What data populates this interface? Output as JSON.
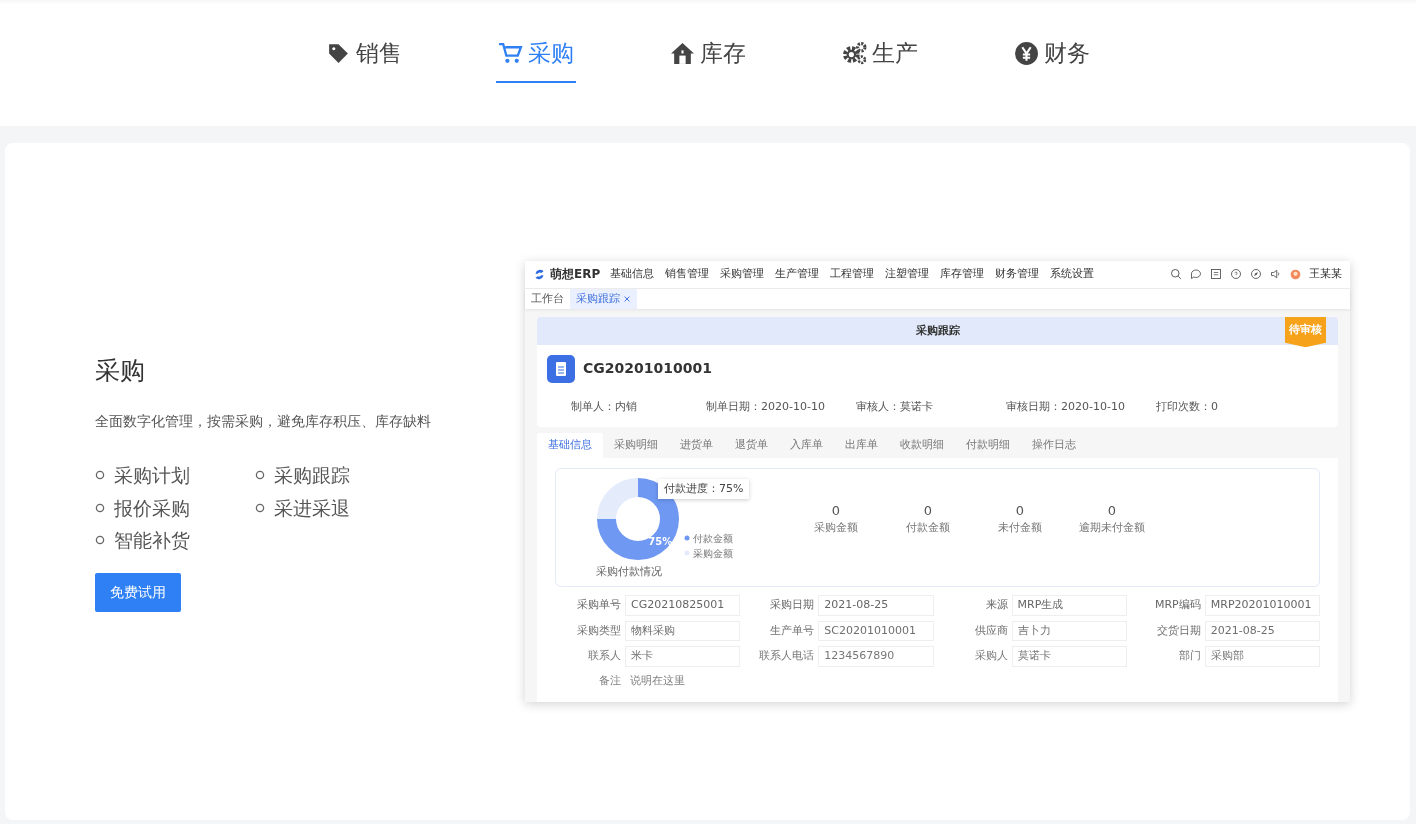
{
  "feature_tabs": [
    {
      "label": "销售",
      "kind": "tag",
      "selected": false
    },
    {
      "label": "采购",
      "kind": "cart",
      "selected": true
    },
    {
      "label": "库存",
      "kind": "house",
      "selected": false
    },
    {
      "label": "生产",
      "kind": "gears",
      "selected": false
    },
    {
      "label": "财务",
      "kind": "yen",
      "selected": false
    }
  ],
  "feature": {
    "title": "采购",
    "description": "全面数字化管理，按需采购，避免库存积压、库存缺料",
    "points": [
      "采购计划",
      "采购跟踪",
      "报价采购",
      "采进采退",
      "智能补货"
    ],
    "button": "免费试用"
  },
  "app_preview": {
    "brand": "萌想ERP",
    "nav": [
      "基础信息",
      "销售管理",
      "采购管理",
      "生产管理",
      "工程管理",
      "注塑管理",
      "库存管理",
      "财务管理",
      "系统设置"
    ],
    "user": "王某某",
    "page_tabs": [
      {
        "label": "工作台",
        "selected": false,
        "closable": false
      },
      {
        "label": "采购跟踪",
        "selected": true,
        "closable": true
      }
    ],
    "panel_title": "采购跟踪",
    "status_badge": "待审核",
    "order_no": "CG20201010001",
    "meta": [
      "制单人：内销",
      "制单日期：2020-10-10",
      "审核人：莫诺卡",
      "审核日期：2020-10-10",
      "打印次数：0"
    ],
    "detail_tabs": [
      {
        "label": "基础信息",
        "selected": true
      },
      {
        "label": "采购明细",
        "selected": false
      },
      {
        "label": "进货单",
        "selected": false
      },
      {
        "label": "退货单",
        "selected": false
      },
      {
        "label": "入库单",
        "selected": false
      },
      {
        "label": "出库单",
        "selected": false
      },
      {
        "label": "收款明细",
        "selected": false
      },
      {
        "label": "付款明细",
        "selected": false
      },
      {
        "label": "操作日志",
        "selected": false
      }
    ],
    "chart": {
      "tooltip": "付款进度：75%",
      "chart_data": {
        "type": "donut",
        "title": "采购付款情况",
        "categories": [
          "付款金额",
          "采购金额"
        ],
        "values": [
          75,
          25
        ],
        "value_labels": [
          "75%",
          null
        ]
      }
    },
    "stats": [
      {
        "value": "0",
        "label": "采购金额"
      },
      {
        "value": "0",
        "label": "付款金额"
      },
      {
        "value": "0",
        "label": "未付金额"
      },
      {
        "value": "0",
        "label": "逾期未付金额"
      }
    ],
    "form": [
      {
        "label": "采购单号",
        "value": "CG20210825001"
      },
      {
        "label": "采购日期",
        "value": "2021-08-25"
      },
      {
        "label": "来源",
        "value": "MRP生成"
      },
      {
        "label": "MRP编码",
        "value": "MRP20201010001"
      },
      {
        "label": "采购类型",
        "value": "物料采购"
      },
      {
        "label": "生产单号",
        "value": "SC20201010001"
      },
      {
        "label": "供应商",
        "value": "吉卜力"
      },
      {
        "label": "交货日期",
        "value": "2021-08-25"
      },
      {
        "label": "联系人",
        "value": "米卡"
      },
      {
        "label": "联系人电话",
        "value": "1234567890"
      },
      {
        "label": "采购人",
        "value": "莫诺卡"
      },
      {
        "label": "部门",
        "value": "采购部"
      },
      {
        "label": "备注",
        "value": "说明在这里"
      }
    ]
  }
}
